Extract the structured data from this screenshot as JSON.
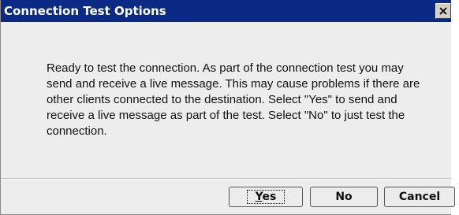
{
  "dialog": {
    "title": "Connection Test Options",
    "message": "Ready to test the connection.  As part of the connection test you may send and receive a live message.  This may cause problems if there are other clients connected to the destination. Select \"Yes\" to send and receive a live message as part of the test.  Select \"No\" to just test the connection."
  },
  "buttons": {
    "yes_mnemonic": "Y",
    "yes_rest": "es",
    "no_label": "No",
    "cancel_label": "Cancel"
  },
  "colors": {
    "titlebar": "#0a2a86",
    "dialog_bg": "#ededed"
  },
  "icons": {
    "close": "close-icon"
  }
}
